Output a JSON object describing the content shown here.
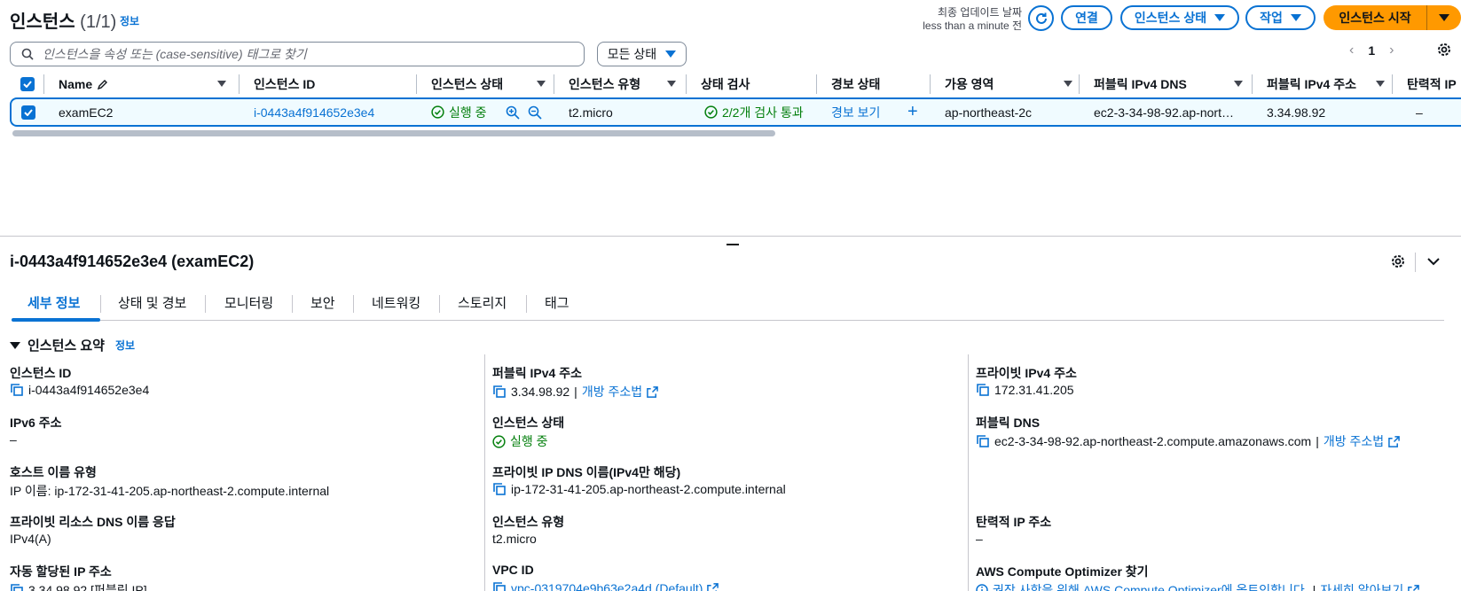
{
  "header": {
    "title": "인스턴스",
    "count": "(1/1)",
    "info": "정보",
    "last_update_label": "최종 업데이트 날짜",
    "last_update_value": "less than a minute 전",
    "connect": "연결",
    "instance_state": "인스턴스 상태",
    "actions": "작업",
    "launch": "인스턴스 시작"
  },
  "search": {
    "placeholder": "인스턴스을 속성 또는 (case-sensitive) 태그로 찾기"
  },
  "filter": {
    "label": "모든 상태"
  },
  "pager": {
    "page": "1"
  },
  "table": {
    "headers": {
      "name": "Name",
      "id": "인스턴스 ID",
      "state": "인스턴스 상태",
      "type": "인스턴스 유형",
      "check": "상태 검사",
      "alarm": "경보 상태",
      "az": "가용 영역",
      "dns": "퍼블릭 IPv4 DNS",
      "ipv4": "퍼블릭 IPv4 주소",
      "elastic": "탄력적 IP"
    },
    "row": {
      "name": "examEC2",
      "id": "i-0443a4f914652e3e4",
      "state": "실행 중",
      "type": "t2.micro",
      "check": "2/2개 검사 통과",
      "alarm": "경보 보기",
      "az": "ap-northeast-2c",
      "dns": "ec2-3-34-98-92.ap-nort…",
      "ipv4": "3.34.98.92",
      "elastic": "–"
    }
  },
  "details": {
    "title": "i-0443a4f914652e3e4 (examEC2)",
    "tabs": [
      "세부 정보",
      "상태 및 경보",
      "모니터링",
      "보안",
      "네트워킹",
      "스토리지",
      "태그"
    ],
    "summary_title": "인스턴스 요약",
    "summary_info": "정보",
    "col1": [
      {
        "key": "인스턴스 ID",
        "value": "i-0443a4f914652e3e4"
      },
      {
        "key": "IPv6 주소",
        "value": "–"
      },
      {
        "key": "호스트 이름 유형",
        "value": "IP 이름: ip-172-31-41-205.ap-northeast-2.compute.internal"
      },
      {
        "key": "프라이빗 리소스 DNS 이름 응답",
        "value": "IPv4(A)"
      },
      {
        "key": "자동 할당된 IP 주소",
        "value": "3.34.98.92 [퍼블릭 IP]"
      }
    ],
    "col2": [
      {
        "key": "퍼블릭 IPv4 주소",
        "value": "3.34.98.92",
        "link": "개방 주소법"
      },
      {
        "key": "인스턴스 상태",
        "value": "실행 중"
      },
      {
        "key": "프라이빗 IP DNS 이름(IPv4만 해당)",
        "value": "ip-172-31-41-205.ap-northeast-2.compute.internal"
      },
      {
        "key": "인스턴스 유형",
        "value": "t2.micro"
      },
      {
        "key": "VPC ID",
        "value": "vpc-0319704e9b63e2a4d (Default)"
      }
    ],
    "col3": [
      {
        "key": "프라이빗 IPv4 주소",
        "value": "172.31.41.205"
      },
      {
        "key": "퍼블릭 DNS",
        "value": "ec2-3-34-98-92.ap-northeast-2.compute.amazonaws.com",
        "link": "개방 주소법"
      },
      {
        "key": "탄력적 IP 주소",
        "value": "–"
      },
      {
        "key": "AWS Compute Optimizer 찾기",
        "value": "권장 사항을 위해 AWS Compute Optimizer에 옵트인합니다.",
        "link": "자세히 알아보기"
      }
    ]
  },
  "colors": {
    "accent": "#0972d3",
    "launch": "#ff9900",
    "success": "#037f0c"
  }
}
